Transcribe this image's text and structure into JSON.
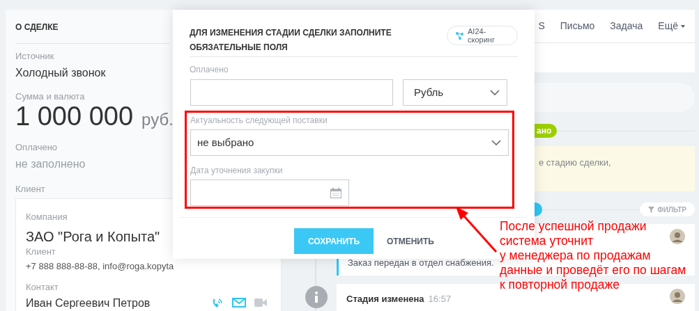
{
  "deal_panel": {
    "title": "О СДЕЛКЕ",
    "fields": [
      {
        "kind": "text",
        "label": "Источник",
        "value": "Холодный звонок"
      },
      {
        "kind": "amount",
        "label": "Сумма и валюта",
        "value": "1 000 000",
        "currency": "руб."
      },
      {
        "kind": "empty",
        "label": "Оплачено",
        "value": "не заполнено"
      }
    ],
    "client": {
      "label": "Клиент",
      "company_label": "Компания",
      "company": "ЗАО \"Рога и Копыта\"",
      "company_role": "Клиент",
      "company_contacts": "+7 888 888-88-88, info@roga.kopyta",
      "contact_label": "Контакт",
      "contact_name": "Иван Сергеевич Петров"
    }
  },
  "activity_tabs": [
    {
      "label": "S",
      "dropdown": false
    },
    {
      "label": "Письмо",
      "dropdown": false
    },
    {
      "label": "Задача",
      "dropdown": false
    },
    {
      "label": "Ещё",
      "dropdown": true
    }
  ],
  "stage_badge": "ано",
  "note_text": "е стадию сделки,",
  "filter_button": "ФИЛЬТР",
  "timeline": [
    {
      "kind": "comment",
      "text": "Заказ передан в отдел снабжения."
    },
    {
      "kind": "event",
      "title": "Стадия изменена",
      "time": "16:57"
    }
  ],
  "modal": {
    "title": "ДЛЯ ИЗМЕНЕНИЯ СТАДИИ СДЕЛКИ ЗАПОЛНИТЕ ОБЯЗАТЕЛЬНЫЕ ПОЛЯ",
    "scoring_button": "AI24-скоринг",
    "paid": {
      "label": "Оплачено",
      "currency": "Рубль"
    },
    "highlighted_fields": [
      {
        "kind": "select",
        "label": "Актуальность следующей поставки",
        "value": "не выбрано"
      },
      {
        "kind": "date",
        "label": "Дата уточнения закупки"
      }
    ],
    "buttons": [
      {
        "kind": "primary",
        "label": "СОХРАНИТЬ"
      },
      {
        "kind": "link",
        "label": "ОТМЕНИТЬ"
      }
    ]
  },
  "annotation": {
    "lines": [
      "После успешной продажи",
      "система уточнит",
      "у менеджера по продажам",
      "данные и проведёт его по шагам",
      "к повторной продаже"
    ]
  }
}
